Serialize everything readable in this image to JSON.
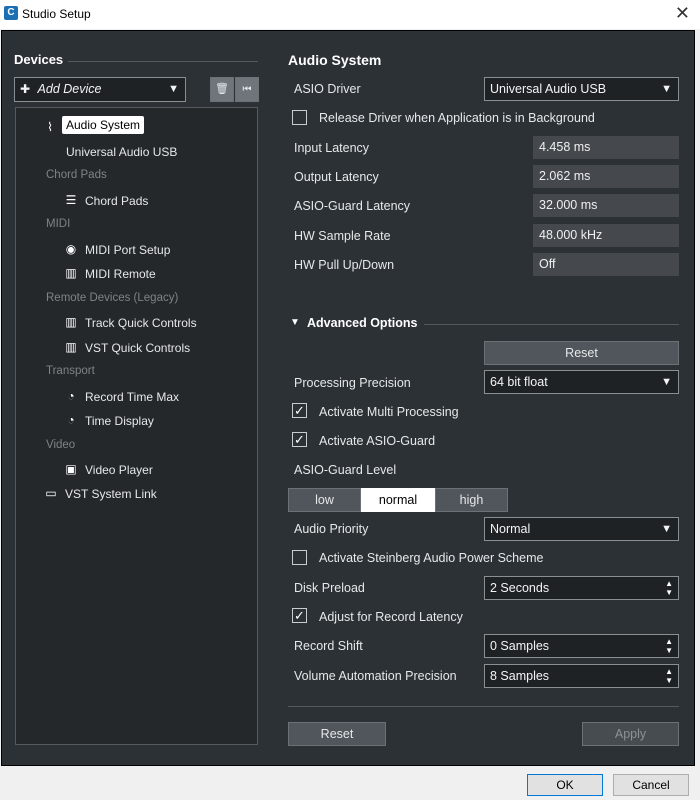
{
  "window": {
    "app_icon": "C",
    "title": "Studio Setup",
    "close_glyph": "✕"
  },
  "devices": {
    "header": "Devices",
    "add_device": "Add Device",
    "tree": [
      {
        "type": "item",
        "icon": "waveform-icon",
        "glyph": "⌇",
        "label": "Audio System",
        "selected": true
      },
      {
        "type": "sub",
        "label": "Universal Audio USB"
      },
      {
        "type": "category",
        "label": "Chord Pads"
      },
      {
        "type": "item",
        "icon": "chord-pads-icon",
        "glyph": "☰",
        "label": "Chord Pads"
      },
      {
        "type": "category",
        "label": "MIDI"
      },
      {
        "type": "item",
        "icon": "midi-port-icon",
        "glyph": "◉",
        "label": "MIDI Port Setup"
      },
      {
        "type": "item",
        "icon": "midi-keyboard-icon",
        "glyph": "▥",
        "label": "MIDI Remote"
      },
      {
        "type": "category",
        "label": "Remote Devices (Legacy)"
      },
      {
        "type": "item",
        "icon": "midi-keyboard-icon",
        "glyph": "▥",
        "label": "Track Quick Controls"
      },
      {
        "type": "item",
        "icon": "midi-keyboard-icon",
        "glyph": "▥",
        "label": "VST Quick Controls"
      },
      {
        "type": "category",
        "label": "Transport"
      },
      {
        "type": "item",
        "icon": "clock-icon",
        "glyph": "◔",
        "label": "Record Time Max"
      },
      {
        "type": "item",
        "icon": "clock-icon",
        "glyph": "◔",
        "label": "Time Display"
      },
      {
        "type": "category",
        "label": "Video"
      },
      {
        "type": "item",
        "icon": "film-icon",
        "glyph": "▣",
        "label": "Video Player"
      },
      {
        "type": "item",
        "icon": "monitor-icon",
        "glyph": "▭",
        "label": "VST System Link"
      }
    ]
  },
  "audio_system": {
    "header": "Audio System",
    "asio_driver_label": "ASIO Driver",
    "asio_driver_value": "Universal Audio USB",
    "release_driver_label": "Release Driver when Application is in Background",
    "release_driver_checked": false,
    "input_latency_label": "Input Latency",
    "input_latency_value": "4.458 ms",
    "output_latency_label": "Output Latency",
    "output_latency_value": "2.062 ms",
    "asio_guard_latency_label": "ASIO-Guard Latency",
    "asio_guard_latency_value": "32.000 ms",
    "hw_sample_rate_label": "HW Sample Rate",
    "hw_sample_rate_value": "48.000 kHz",
    "hw_pull_label": "HW Pull Up/Down",
    "hw_pull_value": "Off"
  },
  "advanced": {
    "header": "Advanced Options",
    "reset_label": "Reset",
    "processing_precision_label": "Processing Precision",
    "processing_precision_value": "64 bit float",
    "multi_processing_label": "Activate Multi Processing",
    "multi_processing_checked": true,
    "asio_guard_label": "Activate ASIO-Guard",
    "asio_guard_checked": true,
    "asio_guard_level_label": "ASIO-Guard Level",
    "asio_guard_levels": [
      "low",
      "normal",
      "high"
    ],
    "asio_guard_level_selected": "normal",
    "audio_priority_label": "Audio Priority",
    "audio_priority_value": "Normal",
    "power_scheme_label": "Activate Steinberg Audio Power Scheme",
    "power_scheme_checked": false,
    "disk_preload_label": "Disk Preload",
    "disk_preload_value": "2 Seconds",
    "adjust_latency_label": "Adjust for Record Latency",
    "adjust_latency_checked": true,
    "record_shift_label": "Record Shift",
    "record_shift_value": "0 Samples",
    "volume_precision_label": "Volume Automation Precision",
    "volume_precision_value": "8 Samples"
  },
  "footer": {
    "reset_label": "Reset",
    "apply_label": "Apply"
  },
  "dialog_buttons": {
    "ok_label": "OK",
    "cancel_label": "Cancel"
  },
  "glyphs": {
    "dropdown_arrow": "▼",
    "collapse_arrow": "▼",
    "spin_up": "▲",
    "spin_down": "▼",
    "check": "✓",
    "plus": "✚",
    "trash": "🗑",
    "reset_device": "⏮"
  },
  "colors": {
    "panel_bg": "#2c3135",
    "tree_bg": "#24282b",
    "field_bg": "#45494d",
    "selected_bg": "#ffffff",
    "accent": "#0078d7"
  }
}
